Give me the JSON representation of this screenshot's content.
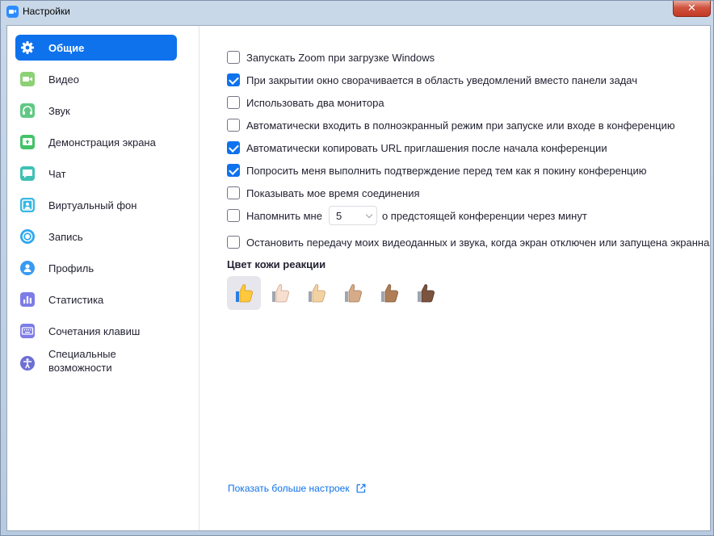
{
  "window": {
    "title": "Настройки",
    "close_label": "✕"
  },
  "sidebar": {
    "items": [
      {
        "label": "Общие",
        "icon": "gear-icon",
        "color": "#ffffff",
        "active": true
      },
      {
        "label": "Видео",
        "icon": "video-icon",
        "color": "#8dd175"
      },
      {
        "label": "Звук",
        "icon": "headphones-icon",
        "color": "#5fc983"
      },
      {
        "label": "Демонстрация экрана",
        "icon": "share-screen-icon",
        "color": "#43c268"
      },
      {
        "label": "Чат",
        "icon": "chat-icon",
        "color": "#3ec1b4"
      },
      {
        "label": "Виртуальный фон",
        "icon": "virtual-background-icon",
        "color": "#3ab8e2"
      },
      {
        "label": "Запись",
        "icon": "record-icon",
        "color": "#2ea7ef"
      },
      {
        "label": "Профиль",
        "icon": "profile-icon",
        "color": "#3a9af2"
      },
      {
        "label": "Статистика",
        "icon": "statistics-icon",
        "color": "#7d7ce8"
      },
      {
        "label": "Сочетания клавиш",
        "icon": "keyboard-icon",
        "color": "#7d7ce8"
      },
      {
        "label": "Специальные возможности",
        "icon": "accessibility-icon",
        "color": "#6d6fd6"
      }
    ]
  },
  "general": {
    "options": [
      {
        "label": "Запускать Zoom при загрузке Windows",
        "checked": false
      },
      {
        "label": "При закрытии окно сворачивается в область уведомлений вместо панели задач",
        "checked": true
      },
      {
        "label": "Использовать два монитора",
        "checked": false
      },
      {
        "label": "Автоматически входить в полноэкранный режим при запуске или входе в конференцию",
        "checked": false
      },
      {
        "label": "Автоматически копировать URL приглашения после начала конференции",
        "checked": true
      },
      {
        "label": "Попросить меня выполнить подтверждение перед тем как я покину конференцию",
        "checked": true
      },
      {
        "label": "Показывать мое время соединения",
        "checked": false
      }
    ],
    "reminder": {
      "label_before": "Напомнить мне",
      "value": "5",
      "label_after": "о предстоящей конференции через минут",
      "checked": false
    },
    "stop_video": {
      "label": "Остановить передачу моих видеоданных и звука, когда экран отключен или запущена экранная",
      "checked": false
    },
    "reaction_skin": {
      "title": "Цвет кожи реакции",
      "tones": [
        "#ffc83d",
        "#f7dece",
        "#f3d2a2",
        "#d5ab88",
        "#af7e57",
        "#7c533e"
      ],
      "selected": 0
    },
    "more_settings": "Показать больше настроек"
  },
  "colors": {
    "accent": "#0e72ed"
  }
}
